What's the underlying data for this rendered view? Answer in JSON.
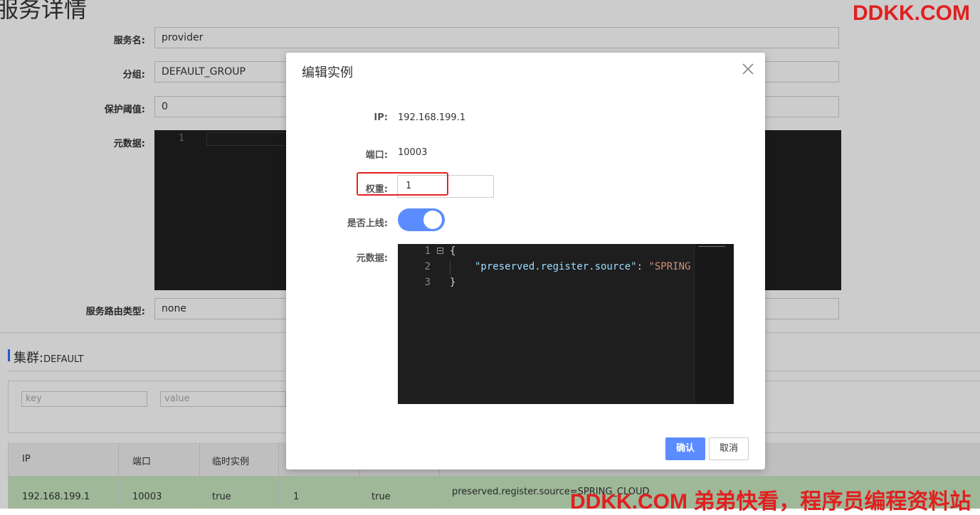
{
  "page": {
    "title": "服务详情",
    "fields": {
      "service_name_label": "服务名:",
      "service_name_value": "provider",
      "group_label": "分组:",
      "group_value": "DEFAULT_GROUP",
      "threshold_label": "保护阈值:",
      "threshold_value": "0",
      "metadata_label": "元数据:",
      "metadata_line_number": "1",
      "route_type_label": "服务路由类型:",
      "route_type_value": "none"
    },
    "cluster": {
      "label": "集群:",
      "name": "DEFAULT",
      "filter_key_placeholder": "key",
      "filter_value_placeholder": "value"
    },
    "table": {
      "columns": [
        "IP",
        "端口",
        "临时实例"
      ],
      "row": {
        "ip": "192.168.199.1",
        "port": "10003",
        "ephemeral": "true",
        "weight": "1",
        "healthy": "true",
        "metadata": "preserved.register.source=SPRING_CLOUD"
      }
    }
  },
  "dialog": {
    "title": "编辑实例",
    "close_icon": "close-icon",
    "ip_label": "IP:",
    "ip_value": "192.168.199.1",
    "port_label": "端口:",
    "port_value": "10003",
    "weight_label": "权重:",
    "weight_value": "1",
    "online_label": "是否上线:",
    "online": true,
    "metadata_label": "元数据:",
    "code": {
      "line_numbers": [
        "1",
        "2",
        "3"
      ],
      "open_brace": "{",
      "key": "\"preserved.register.source\"",
      "separator": ": ",
      "value_visible": "\"SPRING",
      "close_brace": "}"
    },
    "confirm_label": "确认",
    "cancel_label": "取消"
  },
  "watermark": {
    "top": "DDKK.COM",
    "bottom": "DDKK.COM 弟弟快看，程序员编程资料站"
  },
  "colors": {
    "accent": "#5b8cff",
    "highlight_border": "#e52222",
    "watermark": "#e02020",
    "table_row_bg": "#c6e6bf",
    "editor_bg": "#1e1e1e"
  }
}
